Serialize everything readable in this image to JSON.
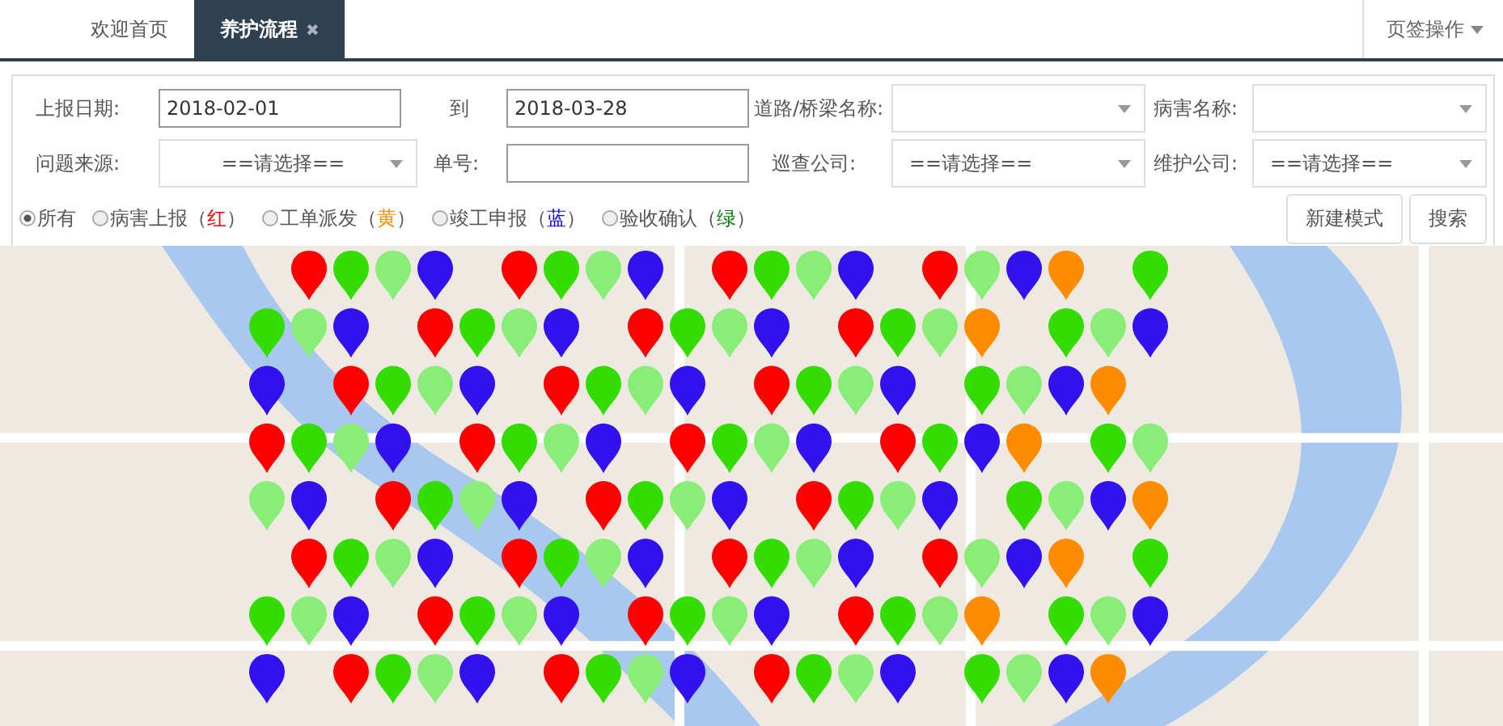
{
  "tabs": [
    {
      "label": "欢迎首页",
      "selected": false
    },
    {
      "label": "养护流程",
      "selected": true,
      "close": "✖"
    }
  ],
  "tab_menu": {
    "label": "页签操作"
  },
  "filters": {
    "report_date_label": "上报日期:",
    "date_from": "2018-02-01",
    "to_label": "到",
    "date_to": "2018-03-28",
    "road_label": "道路/桥梁名称:",
    "disease_label": "病害名称:",
    "source_label": "问题来源:",
    "source_value": "==请选择==",
    "number_label": "单号:",
    "patrol_label": "巡查公司:",
    "patrol_value": "==请选择==",
    "maint_label": "维护公司:",
    "maint_value": "==请选择=="
  },
  "status_radios": [
    {
      "label": "所有",
      "selected": true
    },
    {
      "label": "病害上报（",
      "color_word": "红",
      "close": "）",
      "color": "#ff0000",
      "selected": false
    },
    {
      "label": "工单派发（",
      "color_word": "黄",
      "close": "）",
      "color": "#ff8c00",
      "selected": false
    },
    {
      "label": "竣工申报（",
      "color_word": "蓝",
      "close": "）",
      "color": "#0000ff",
      "selected": false
    },
    {
      "label": "验收确认（",
      "color_word": "绿",
      "close": "）",
      "color": "#008000",
      "selected": false
    }
  ],
  "buttons": [
    "新建模式",
    "搜索"
  ]
}
